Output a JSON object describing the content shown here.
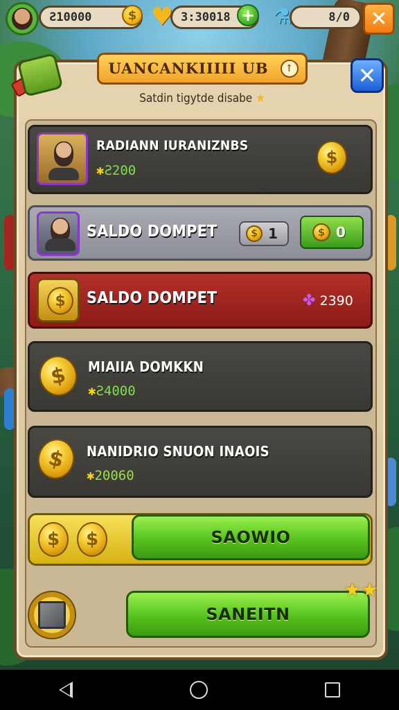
{
  "hud": {
    "currency1": "Ƨ10000",
    "currency2": "3:30018",
    "currency3": "8/0",
    "coin_icon": "coin-icon",
    "heart_icon": "gold-heart-icon",
    "plus_icon": "plus-icon",
    "potion_icon": "potion-icon",
    "close_icon": "close-icon"
  },
  "dialog": {
    "title": "UANCANKIIIII UB",
    "info_glyph": "↑",
    "subtitle": "Satdin tigytde disabe",
    "subtitle_star": "★",
    "close_glyph": "✕"
  },
  "rows": [
    {
      "label": "RADIANN IURANIZNBS",
      "value_star": "✱",
      "value": "Ƨ200"
    },
    {
      "label": "SALDO DOMPET",
      "chip1_value": "1",
      "chip2_value": "0"
    },
    {
      "label": "SALDO DOMPET",
      "value_icon": "✤",
      "value": "2390"
    },
    {
      "label": "MIAIIA DOMKKN",
      "value_star": "✱",
      "value": "Ƨ4000"
    },
    {
      "label": "NANIDRIO SNUON INAOIS",
      "value_star": "✱",
      "value": "20060"
    }
  ],
  "buttons": {
    "primary": "SAOWIO",
    "secondary": "SANEITN",
    "stars": "★★"
  },
  "colors": {
    "primary_green": "#56c21e",
    "panel": "#e6d4b0",
    "title_banner": "#f2a32a",
    "close_blue": "#1f5ed6",
    "highlight_red": "#b5302a"
  }
}
